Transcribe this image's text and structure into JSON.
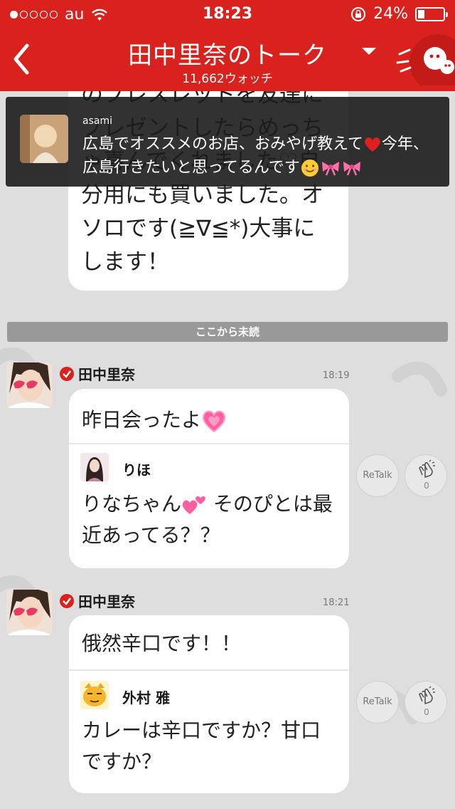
{
  "status_bar": {
    "carrier": "au",
    "time": "18:23",
    "battery": "24%",
    "battery_level": 0.24
  },
  "header": {
    "title": "田中里奈のトーク",
    "watch_count": "11,662ウォッチ"
  },
  "background_message": {
    "text": "のブレスレットを友達にプレゼントしたらめっちゃ喜んでくれました♡自分用にも買いました。オソロです(≧∇≦*)大事にします！"
  },
  "notification": {
    "user": "asami",
    "text_part1": "広島でオススメのお店、おみやげ教えて",
    "text_part2": "今年、広島行きたいと思ってるんです"
  },
  "unread_divider": "ここから未読",
  "messages": [
    {
      "sender": "田中里奈",
      "time": "18:19",
      "text": "昨日会ったよ",
      "reply_user": "りほ",
      "reply_text_a": "りなちゃん",
      "reply_text_b": " そのぴとは最近あってる？？",
      "retalk_label": "ReTalk",
      "clap_count": "0"
    },
    {
      "sender": "田中里奈",
      "time": "18:21",
      "text": "俄然辛口です！！",
      "reply_user": "外村 雅",
      "reply_text": "カレーは辛口ですか？甘口ですか？",
      "retalk_label": "ReTalk",
      "clap_count": "0"
    }
  ],
  "colors": {
    "brand_red": "#d9221e",
    "chat_bg": "#dedede",
    "notification_bg": "#1c1c1c",
    "unread_bar": "#999999"
  },
  "icons": [
    "signal-dots-icon",
    "wifi-icon",
    "rotation-lock-icon",
    "battery-icon",
    "back-arrow-icon",
    "dropdown-caret-icon",
    "mascot-icon",
    "verified-icon",
    "clap-icon",
    "heart-emoji",
    "smile-emoji",
    "ribbon-emoji",
    "pink-heart-emoji",
    "two-hearts-emoji"
  ]
}
